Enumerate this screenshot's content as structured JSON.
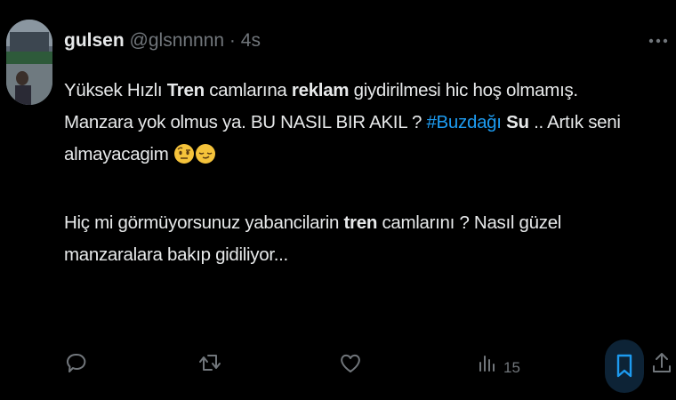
{
  "tweet": {
    "author_name": "gulsen",
    "author_handle": "@glsnnnnn",
    "separator": " · ",
    "time": "4s",
    "line1_a": "Yüksek Hızlı ",
    "line1_b": "Tren",
    "line1_c": " camlarına ",
    "line1_d": "reklam",
    "line1_e": " giydirilmesi hic hoş olmamış.",
    "line2_a": "Manzara yok olmus ya. BU NASIL BIR AKIL ?  ",
    "line2_hashtag": "#Buzdağı",
    "line2_sp": " ",
    "line2_b": "Su",
    "line2_c": " .. Artık seni",
    "line3": "almayacagim",
    "line4_a": "Hiç mi görmüyorsunuz yabancilarin ",
    "line4_b": "tren",
    "line4_c": " camlarını ?  Nasıl güzel",
    "line5": "manzaralara bakıp gidiliyor..."
  },
  "actions": {
    "views_count": "15"
  },
  "colors": {
    "background": "#000000",
    "text": "#e7e9ea",
    "secondary": "#71767b",
    "accent": "#1d9bf0"
  },
  "icons": [
    "more-icon",
    "reply-icon",
    "retweet-icon",
    "like-icon",
    "views-icon",
    "bookmark-icon",
    "share-icon",
    "emoji-raised-eyebrow",
    "emoji-relieved-face"
  ]
}
